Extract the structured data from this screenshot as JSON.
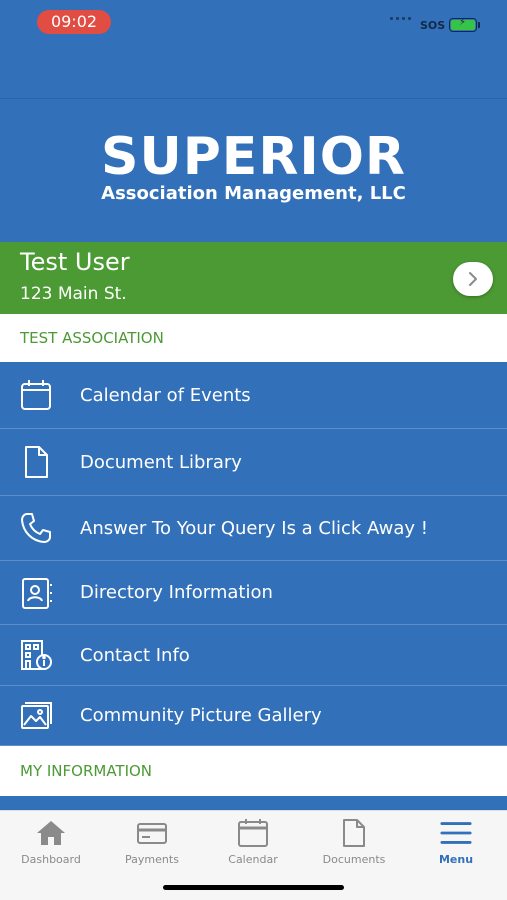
{
  "status_bar": {
    "time": "09:02",
    "carrier": "SOS"
  },
  "brand": {
    "title": "SUPERIOR",
    "subtitle": "Association Management, LLC"
  },
  "user": {
    "name": "Test User",
    "address": "123 Main St."
  },
  "sections": {
    "association_header": "TEST ASSOCIATION",
    "my_information_header": "MY INFORMATION"
  },
  "menu": {
    "items": [
      {
        "label": "Calendar of Events",
        "icon": "calendar-icon"
      },
      {
        "label": "Document Library",
        "icon": "document-icon"
      },
      {
        "label": "Answer To Your Query Is a Click Away !",
        "icon": "phone-icon"
      },
      {
        "label": "Directory Information",
        "icon": "contact-book-icon"
      },
      {
        "label": "Contact Info",
        "icon": "building-info-icon"
      },
      {
        "label": "Community Picture Gallery",
        "icon": "gallery-icon"
      }
    ]
  },
  "tabs": [
    {
      "label": "Dashboard",
      "icon": "home-icon"
    },
    {
      "label": "Payments",
      "icon": "credit-card-icon"
    },
    {
      "label": "Calendar",
      "icon": "calendar-icon"
    },
    {
      "label": "Documents",
      "icon": "document-icon"
    },
    {
      "label": "Menu",
      "icon": "menu-icon",
      "active": true
    }
  ],
  "colors": {
    "primary_blue": "#3270b9",
    "accent_green": "#4b9a34",
    "time_pill_red": "#e24d43",
    "tab_inactive": "#8a8a8a"
  }
}
